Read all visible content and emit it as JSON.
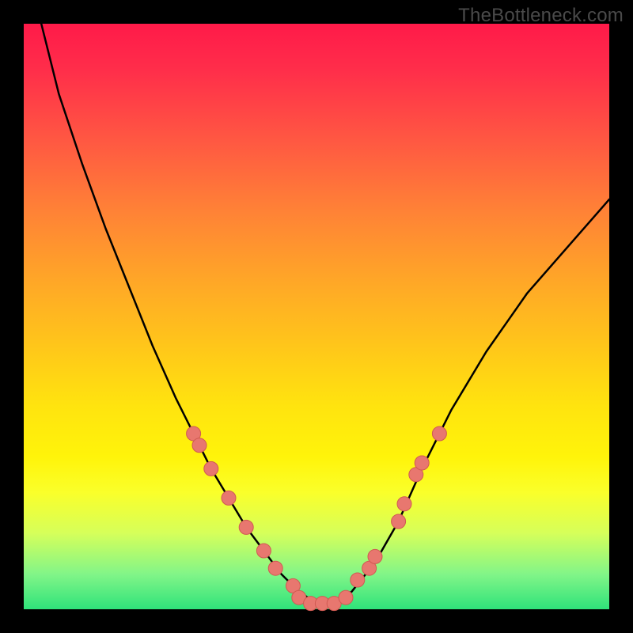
{
  "watermark": "TheBottleneck.com",
  "chart_data": {
    "type": "line",
    "title": "",
    "xlabel": "",
    "ylabel": "",
    "xlim": [
      0,
      100
    ],
    "ylim": [
      0,
      100
    ],
    "grid": false,
    "legend": false,
    "series": [
      {
        "name": "curve",
        "color": "#000000",
        "x": [
          3,
          6,
          10,
          14,
          18,
          22,
          26,
          29,
          32,
          35,
          38,
          41,
          44,
          47,
          50,
          53,
          56,
          60,
          64,
          68,
          73,
          79,
          86,
          93,
          100
        ],
        "y": [
          100,
          88,
          76,
          65,
          55,
          45,
          36,
          30,
          24,
          19,
          14,
          10,
          6,
          3,
          1,
          1,
          3,
          8,
          15,
          24,
          34,
          44,
          54,
          62,
          70
        ]
      }
    ],
    "markers": [
      {
        "x": 29,
        "y": 30
      },
      {
        "x": 30,
        "y": 28
      },
      {
        "x": 32,
        "y": 24
      },
      {
        "x": 35,
        "y": 19
      },
      {
        "x": 38,
        "y": 14
      },
      {
        "x": 41,
        "y": 10
      },
      {
        "x": 43,
        "y": 7
      },
      {
        "x": 46,
        "y": 4
      },
      {
        "x": 47,
        "y": 2
      },
      {
        "x": 49,
        "y": 1
      },
      {
        "x": 51,
        "y": 1
      },
      {
        "x": 53,
        "y": 1
      },
      {
        "x": 55,
        "y": 2
      },
      {
        "x": 57,
        "y": 5
      },
      {
        "x": 59,
        "y": 7
      },
      {
        "x": 60,
        "y": 9
      },
      {
        "x": 64,
        "y": 15
      },
      {
        "x": 65,
        "y": 18
      },
      {
        "x": 67,
        "y": 23
      },
      {
        "x": 68,
        "y": 25
      },
      {
        "x": 71,
        "y": 30
      }
    ],
    "marker_style": {
      "fill": "#e8776f",
      "stroke": "#d05a52",
      "radius": 9
    }
  }
}
